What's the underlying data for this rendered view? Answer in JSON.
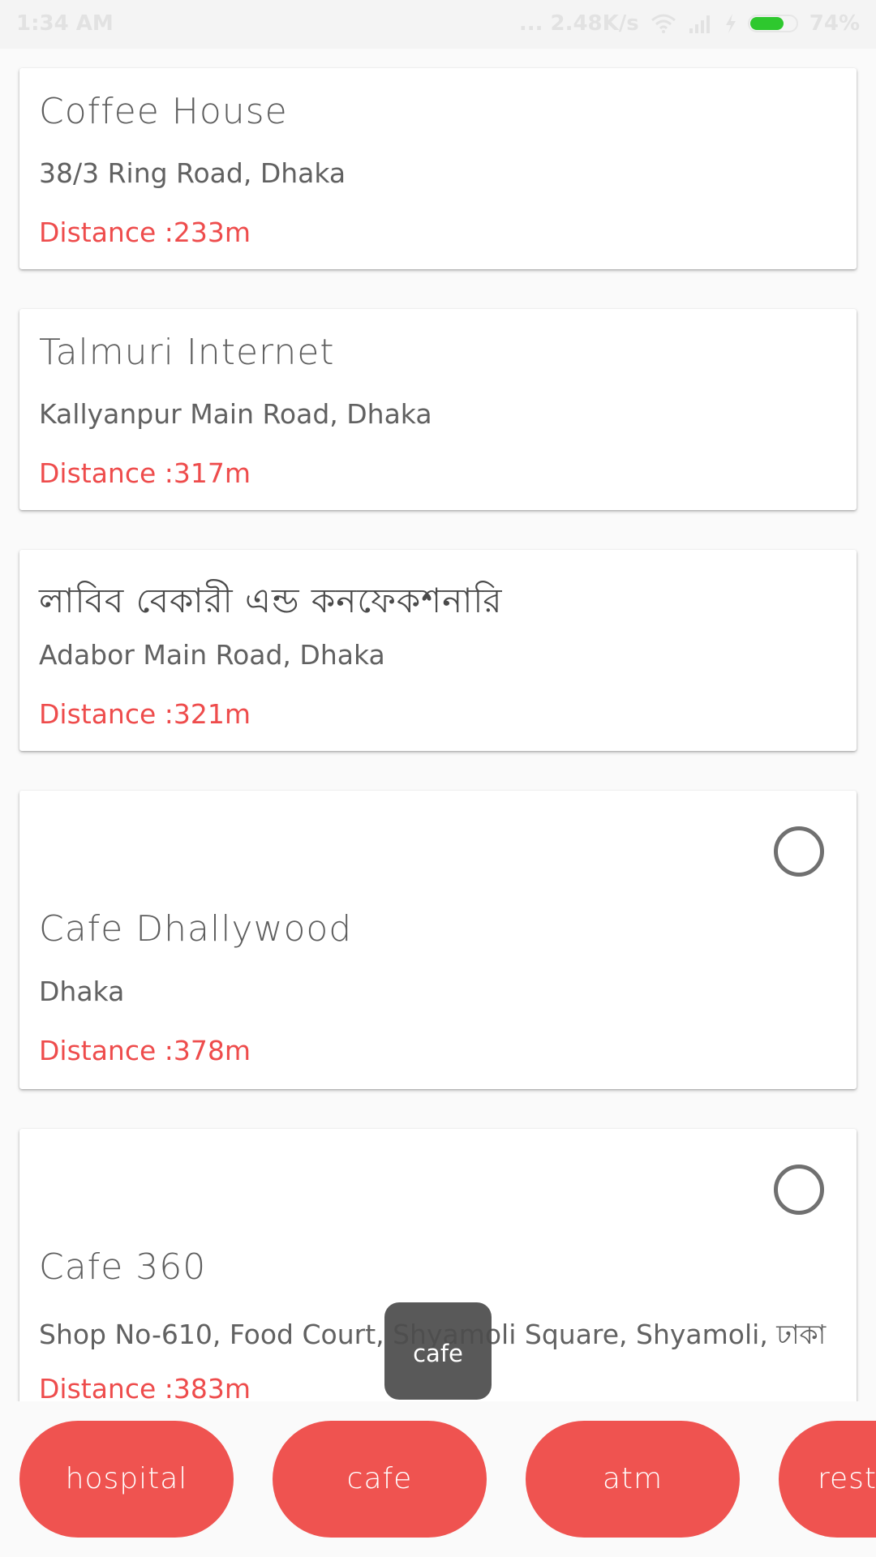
{
  "status_bar": {
    "time": "1:34 AM",
    "network_speed": "... 2.48K/s",
    "battery_percent": "74%",
    "battery_level": 0.74
  },
  "places": [
    {
      "name": "Coffee House",
      "address": "38/3 Ring Road, Dhaka",
      "distance": "Distance :233m"
    },
    {
      "name": "Talmuri Internet",
      "address": "Kallyanpur Main Road, Dhaka",
      "distance": "Distance :317m"
    },
    {
      "name": "লাবিব বেকারী এন্ড কনফেকশনারি",
      "address": "Adabor Main Road, Dhaka",
      "distance": "Distance :321m"
    },
    {
      "name": "Cafe Dhallywood",
      "address": "Dhaka",
      "distance": "Distance :378m"
    },
    {
      "name": "Cafe 360",
      "address": "Shop No-610, Food Court, Shyamoli Square, Shyamoli, ঢাকা",
      "distance": "Distance :383m"
    }
  ],
  "toast": {
    "text": "cafe"
  },
  "categories": [
    {
      "label": "hospital"
    },
    {
      "label": "cafe"
    },
    {
      "label": "atm"
    },
    {
      "label": "resta"
    }
  ],
  "colors": {
    "accent": "#ef5350",
    "distance_text": "#ee4c4c",
    "battery": "#2ec82e"
  }
}
